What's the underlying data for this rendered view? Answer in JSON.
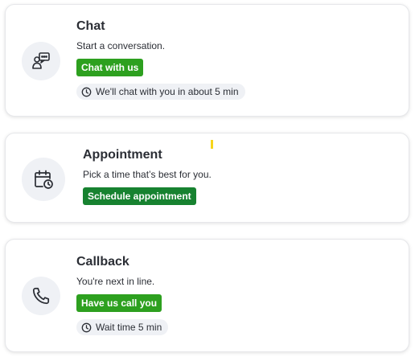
{
  "cards": [
    {
      "title": "Chat",
      "description": "Start a conversation.",
      "button_label": "Chat with us",
      "wait_text": "We'll chat with you in about 5 min",
      "icon": "chat-agent-icon"
    },
    {
      "title": "Appointment",
      "description": "Pick a time that’s best for you.",
      "button_label": "Schedule appointment",
      "icon": "calendar-clock-icon"
    },
    {
      "title": "Callback",
      "description": "You're next in line.",
      "button_label": "Have us call you",
      "wait_text": "Wait time 5 min",
      "icon": "phone-icon"
    }
  ],
  "colors": {
    "button_green": "#2da01f",
    "button_dark_green": "#178230",
    "icon_bg": "#eff1f5",
    "marker": "#f7d51b"
  }
}
